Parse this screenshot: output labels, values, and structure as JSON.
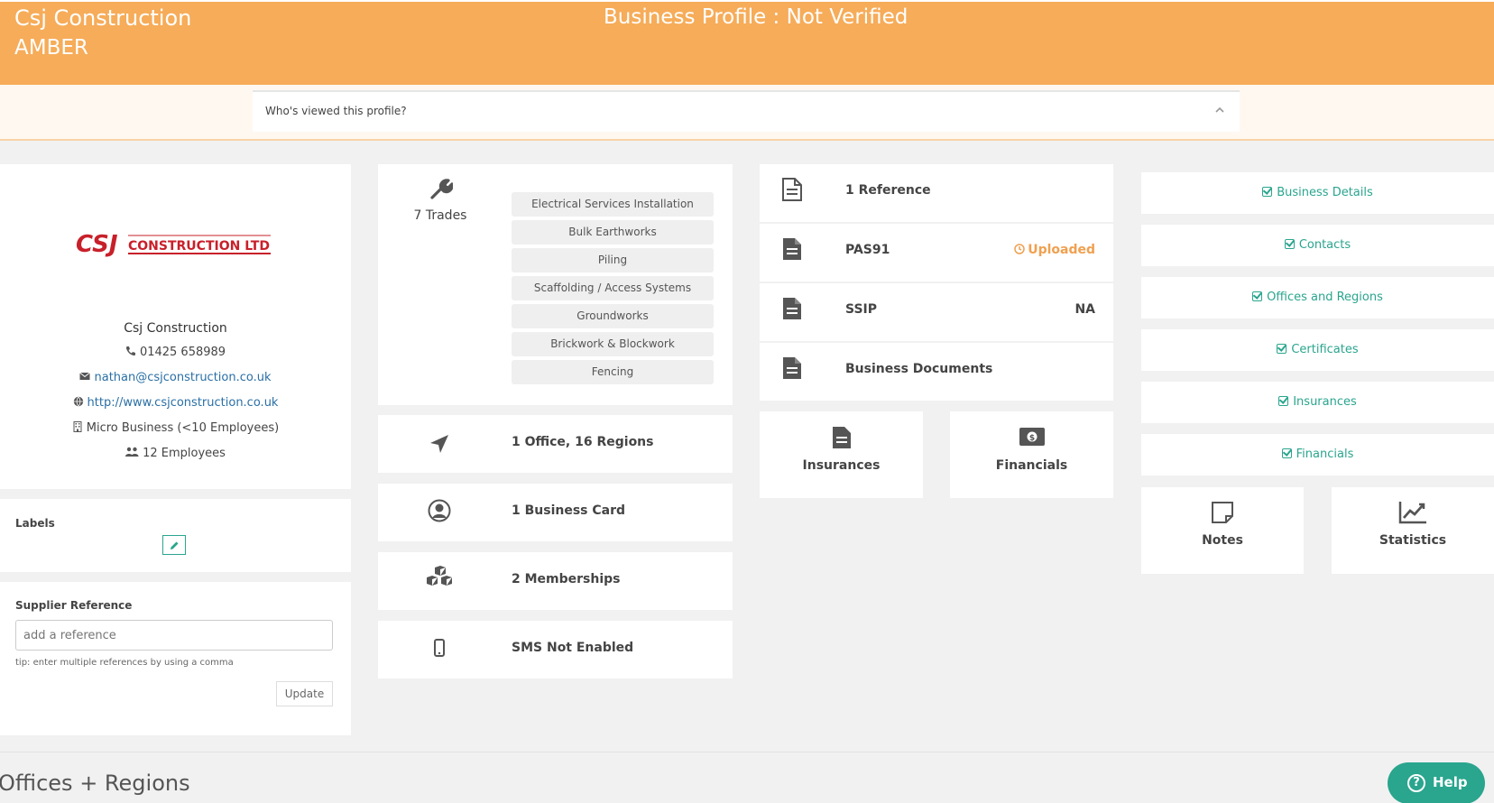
{
  "banner": {
    "company": "Csj Construction",
    "status": "AMBER",
    "profile_status": "Business Profile : Not Verified",
    "color": "#f6ac59"
  },
  "viewed": {
    "label": "Who's viewed this profile?",
    "icon": "chevron-up-icon"
  },
  "profile": {
    "logo_text": "CONSTRUCTION LTD",
    "logo_mark": "CSJ",
    "name": "Csj Construction",
    "phone": "01425 658989",
    "email": "nathan@csjconstruction.co.uk",
    "website": "http://www.csjconstruction.co.uk",
    "size": "Micro Business (<10 Employees)",
    "employees": "12 Employees"
  },
  "labels": {
    "title": "Labels",
    "edit_icon": "pencil-icon"
  },
  "supplier_reference": {
    "title": "Supplier Reference",
    "placeholder": "add a reference",
    "tip": "tip: enter multiple references by using a comma",
    "update_label": "Update"
  },
  "trades": {
    "count_label": "7 Trades",
    "items": [
      "Electrical Services Installation",
      "Bulk Earthworks",
      "Piling",
      "Scaffolding / Access Systems",
      "Groundworks",
      "Brickwork & Blockwork",
      "Fencing"
    ]
  },
  "stats": {
    "offices": "1 Office, 16 Regions",
    "business_card": "1 Business Card",
    "memberships": "2 Memberships",
    "sms": "SMS Not Enabled"
  },
  "documents": {
    "reference": "1 Reference",
    "pas91": "PAS91",
    "pas91_status": "Uploaded",
    "ssip": "SSIP",
    "ssip_status": "NA",
    "business_docs": "Business Documents",
    "status_color": "#f0a050"
  },
  "tiles": {
    "insurances": "Insurances",
    "financials": "Financials",
    "notes": "Notes",
    "statistics": "Statistics"
  },
  "checklist": [
    "Business Details",
    "Contacts",
    "Offices and Regions",
    "Certificates",
    "Insurances",
    "Financials"
  ],
  "section_heading": "Offices + Regions",
  "help": {
    "label": "Help",
    "color": "#2aa58e"
  }
}
